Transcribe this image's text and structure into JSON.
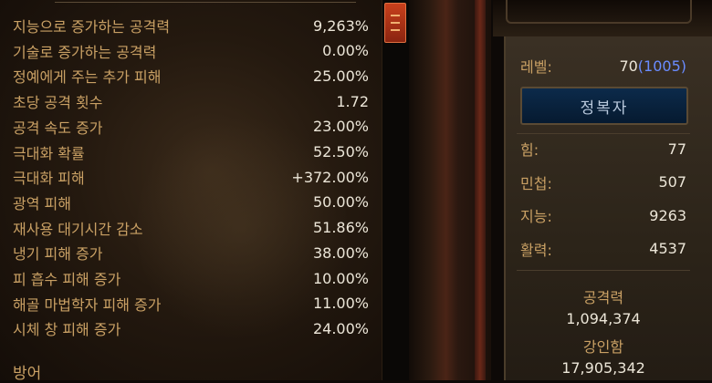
{
  "stats": [
    {
      "label": "지능으로 증가하는 공격력",
      "value": "9,263%"
    },
    {
      "label": "기술로 증가하는 공격력",
      "value": "0.00%"
    },
    {
      "label": "정예에게 주는 추가 피해",
      "value": "25.00%"
    },
    {
      "label": "초당 공격 횟수",
      "value": "1.72"
    },
    {
      "label": "공격 속도 증가",
      "value": "23.00%"
    },
    {
      "label": "극대화 확률",
      "value": "52.50%"
    },
    {
      "label": "극대화 피해",
      "value": "+372.00%"
    },
    {
      "label": "광역 피해",
      "value": "50.00%"
    },
    {
      "label": "재사용 대기시간 감소",
      "value": "51.86%"
    },
    {
      "label": "냉기 피해 증가",
      "value": "38.00%"
    },
    {
      "label": "피 흡수 피해 증가",
      "value": "10.00%"
    },
    {
      "label": "해골 마법학자 피해 증가",
      "value": "11.00%"
    },
    {
      "label": "시체 창 피해 증가",
      "value": "24.00%"
    }
  ],
  "section_next": "방어",
  "character": {
    "level_label": "레벨:",
    "level_value": "70",
    "paragon_value": "(1005)",
    "class_button": "정복자",
    "attributes": [
      {
        "label": "힘:",
        "value": "77"
      },
      {
        "label": "민첩:",
        "value": "507"
      },
      {
        "label": "지능:",
        "value": "9263"
      },
      {
        "label": "활력:",
        "value": "4537"
      }
    ],
    "damage_label": "공격력",
    "damage_value": "1,094,374",
    "toughness_label": "강인함",
    "toughness_value": "17,905,342"
  },
  "colors": {
    "label": "#c9a064",
    "value": "#ece6d8",
    "paragon": "#6a8cff",
    "class_button_bg": "#0c2a4a"
  }
}
